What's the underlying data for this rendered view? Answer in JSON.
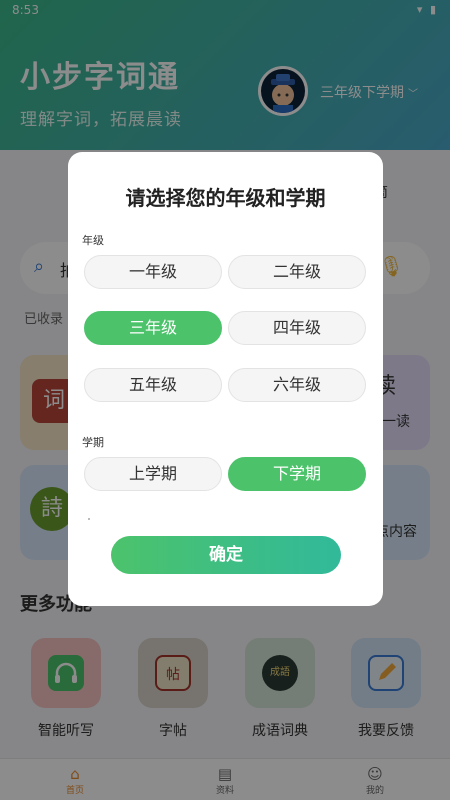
{
  "status": {
    "time": "8:53",
    "icons": "▾▮"
  },
  "header": {
    "title": "小步字词通",
    "subtitle": "理解字词，拓展晨读",
    "grade_select": "三年级下学期"
  },
  "home": {
    "tab_hint": "筒",
    "search_hint": "拍",
    "collected_prefix": "已收录",
    "cards": [
      {
        "glyph": "词",
        "text": ""
      },
      {
        "glyph": "读",
        "text": "一读"
      },
      {
        "glyph": "詩",
        "text": ""
      },
      {
        "glyph": "",
        "text": "点内容"
      }
    ],
    "more_title": "更多功能",
    "functions": [
      {
        "label": "智能听写",
        "icon": "headphones-icon"
      },
      {
        "label": "字帖",
        "icon": "copybook-icon",
        "glyph": "帖"
      },
      {
        "label": "成语词典",
        "icon": "idiom-dict-icon",
        "glyph": "成語"
      },
      {
        "label": "我要反馈",
        "icon": "feedback-icon"
      }
    ]
  },
  "nav": [
    {
      "label": "首页",
      "icon": "home-icon",
      "active": true
    },
    {
      "label": "资料",
      "icon": "document-icon",
      "active": false
    },
    {
      "label": "我的",
      "icon": "profile-icon",
      "active": false
    }
  ],
  "modal": {
    "title": "请选择您的年级和学期",
    "grade_label": "年级",
    "grades": [
      "一年级",
      "二年级",
      "三年级",
      "四年级",
      "五年级",
      "六年级"
    ],
    "selected_grade": "三年级",
    "term_label": "学期",
    "terms": [
      "上学期",
      "下学期"
    ],
    "selected_term": "下学期",
    "confirm": "确定"
  },
  "colors": {
    "accent": "#4cc36b",
    "nav_active": "#e8892c"
  }
}
